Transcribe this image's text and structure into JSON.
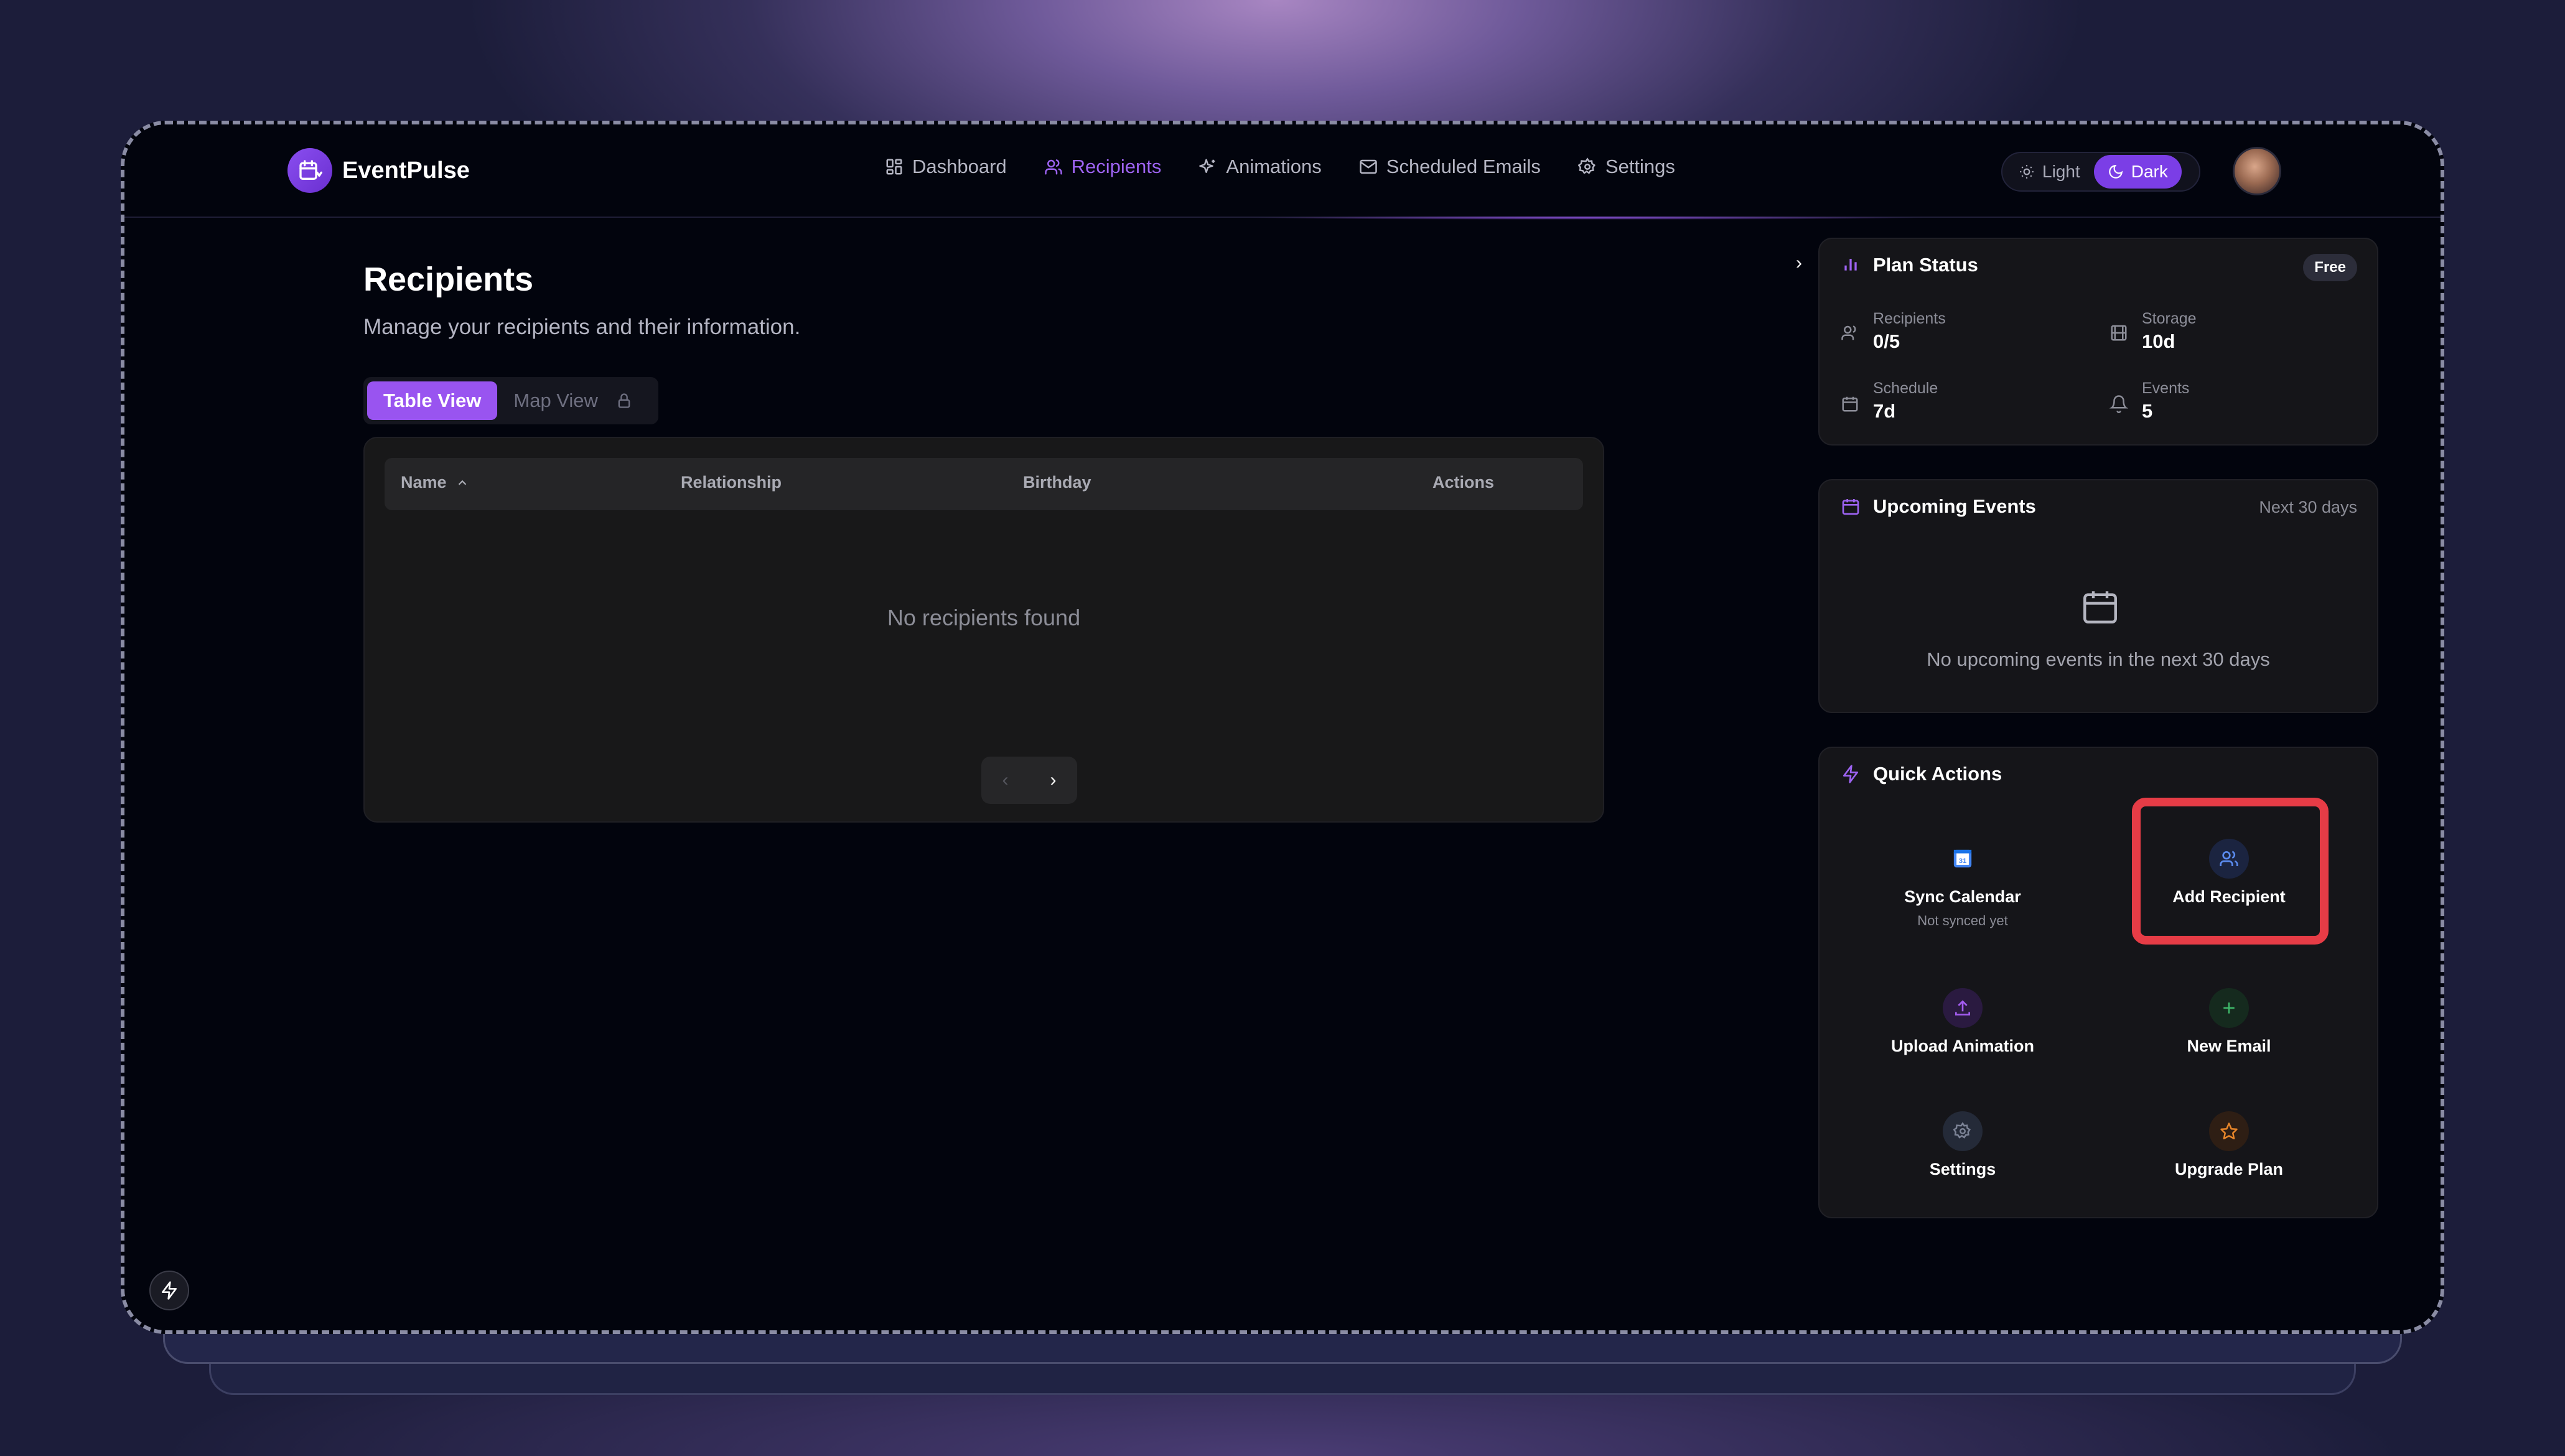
{
  "app": {
    "name": "EventPulse"
  },
  "nav": {
    "items": [
      {
        "label": "Dashboard",
        "icon": "grid-icon",
        "active": false
      },
      {
        "label": "Recipients",
        "icon": "users-icon",
        "active": true
      },
      {
        "label": "Animations",
        "icon": "sparkle-icon",
        "active": false
      },
      {
        "label": "Scheduled Emails",
        "icon": "mail-icon",
        "active": false
      },
      {
        "label": "Settings",
        "icon": "gear-icon",
        "active": false
      }
    ]
  },
  "theme": {
    "light_label": "Light",
    "dark_label": "Dark",
    "selected": "Dark"
  },
  "page": {
    "title": "Recipients",
    "subtitle": "Manage your recipients and their information."
  },
  "view_tabs": {
    "table": "Table View",
    "map": "Map View",
    "selected": "Table View"
  },
  "table": {
    "columns": [
      "Name",
      "Relationship",
      "Birthday",
      "Actions"
    ],
    "sort_column": "Name",
    "sort_direction": "ascending",
    "rows": [],
    "empty_message": "No recipients found"
  },
  "plan_status": {
    "title": "Plan Status",
    "badge": "Free",
    "stats": [
      {
        "label": "Recipients",
        "value": "0/5",
        "icon": "users-icon"
      },
      {
        "label": "Storage",
        "value": "10d",
        "icon": "film-icon"
      },
      {
        "label": "Schedule",
        "value": "7d",
        "icon": "calendar-icon"
      },
      {
        "label": "Events",
        "value": "5",
        "icon": "bell-icon"
      }
    ]
  },
  "upcoming_events": {
    "title": "Upcoming Events",
    "range": "Next 30 days",
    "empty_message": "No upcoming events in the next 30 days"
  },
  "quick_actions": {
    "title": "Quick Actions",
    "items": [
      {
        "label": "Sync Calendar",
        "sub": "Not synced yet",
        "icon": "google-calendar-icon"
      },
      {
        "label": "Add Recipient",
        "icon": "users-icon",
        "highlighted": true
      },
      {
        "label": "Upload Animation",
        "icon": "upload-icon"
      },
      {
        "label": "New Email",
        "icon": "plus-icon"
      },
      {
        "label": "Settings",
        "icon": "gear-icon"
      },
      {
        "label": "Upgrade Plan",
        "icon": "star-icon"
      }
    ]
  },
  "colors": {
    "accent": "#9d63f2",
    "highlight": "#e63c46",
    "background": "#02040d"
  }
}
